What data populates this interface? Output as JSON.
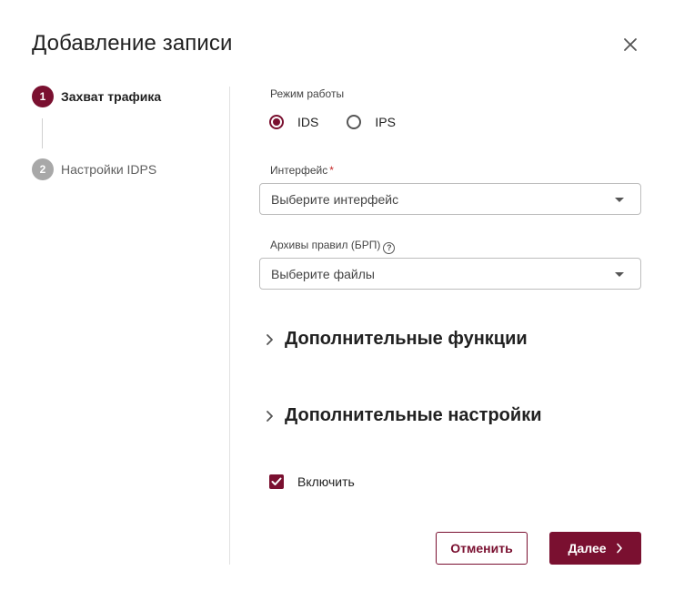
{
  "dialog": {
    "title": "Добавление записи"
  },
  "stepper": {
    "steps": [
      {
        "number": "1",
        "label": "Захват трафика",
        "state": "active"
      },
      {
        "number": "2",
        "label": "Настройки IDPS",
        "state": "inactive"
      }
    ]
  },
  "form": {
    "mode": {
      "label": "Режим работы",
      "options": [
        {
          "label": "IDS",
          "checked": true
        },
        {
          "label": "IPS",
          "checked": false
        }
      ]
    },
    "interface": {
      "label": "Интерфейс",
      "required_mark": "*",
      "placeholder": "Выберите интерфейс"
    },
    "archives": {
      "label": "Архивы правил (БРП)",
      "placeholder": "Выберите файлы"
    },
    "sections": [
      {
        "label": "Дополнительные функции"
      },
      {
        "label": "Дополнительные настройки"
      }
    ],
    "enable": {
      "label": "Включить",
      "checked": true
    }
  },
  "footer": {
    "cancel_label": "Отменить",
    "next_label": "Далее"
  },
  "colors": {
    "accent": "#7a1030",
    "inactive_step": "#a8a8a8"
  }
}
